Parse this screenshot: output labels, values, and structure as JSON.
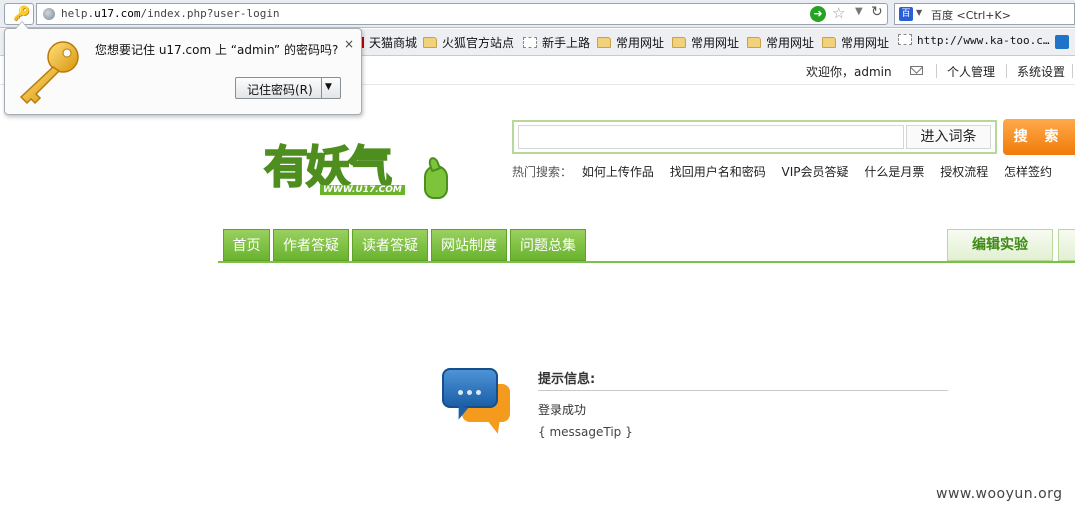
{
  "browser": {
    "url_prefix": "help.",
    "url_domain": "u17.com",
    "url_path": "/index.php?user-login",
    "search_placeholder": "百度 <Ctrl+K>",
    "engine_icon": "百"
  },
  "bookmarks": [
    {
      "label": "天猫商城",
      "icon": "tmall"
    },
    {
      "label": "火狐官方站点",
      "icon": "folder"
    },
    {
      "label": "新手上路",
      "icon": "page"
    },
    {
      "label": "常用网址",
      "icon": "folder"
    },
    {
      "label": "常用网址",
      "icon": "folder"
    },
    {
      "label": "常用网址",
      "icon": "folder"
    },
    {
      "label": "常用网址",
      "icon": "folder"
    },
    {
      "label": "http://www.ka-too.c…",
      "icon": "page"
    }
  ],
  "password_prompt": {
    "question": "您想要记住 u17.com 上 “admin” 的密码吗?",
    "close": "×",
    "remember_label": "记住密码(R)",
    "dropdown": "▼"
  },
  "userbar": {
    "welcome": "欢迎你，admin",
    "links": [
      "个人管理",
      "系统设置"
    ]
  },
  "logo": {
    "text": "有妖气",
    "sub": "WWW.U17.COM"
  },
  "search": {
    "input_value": "",
    "enter_term": "进入词条",
    "submit": "搜 索",
    "hot_label": "热门搜索：",
    "hot_keywords": [
      "如何上传作品",
      "找回用户名和密码",
      "VIP会员答疑",
      "什么是月票",
      "授权流程",
      "怎样签约"
    ]
  },
  "nav": {
    "tabs": [
      "首页",
      "作者答疑",
      "读者答疑",
      "网站制度",
      "问题总集"
    ],
    "right_tab": "编辑实验"
  },
  "message": {
    "title": "提示信息:",
    "text": "登录成功",
    "tip": "{ messageTip }"
  },
  "watermark": "www.wooyun.org"
}
